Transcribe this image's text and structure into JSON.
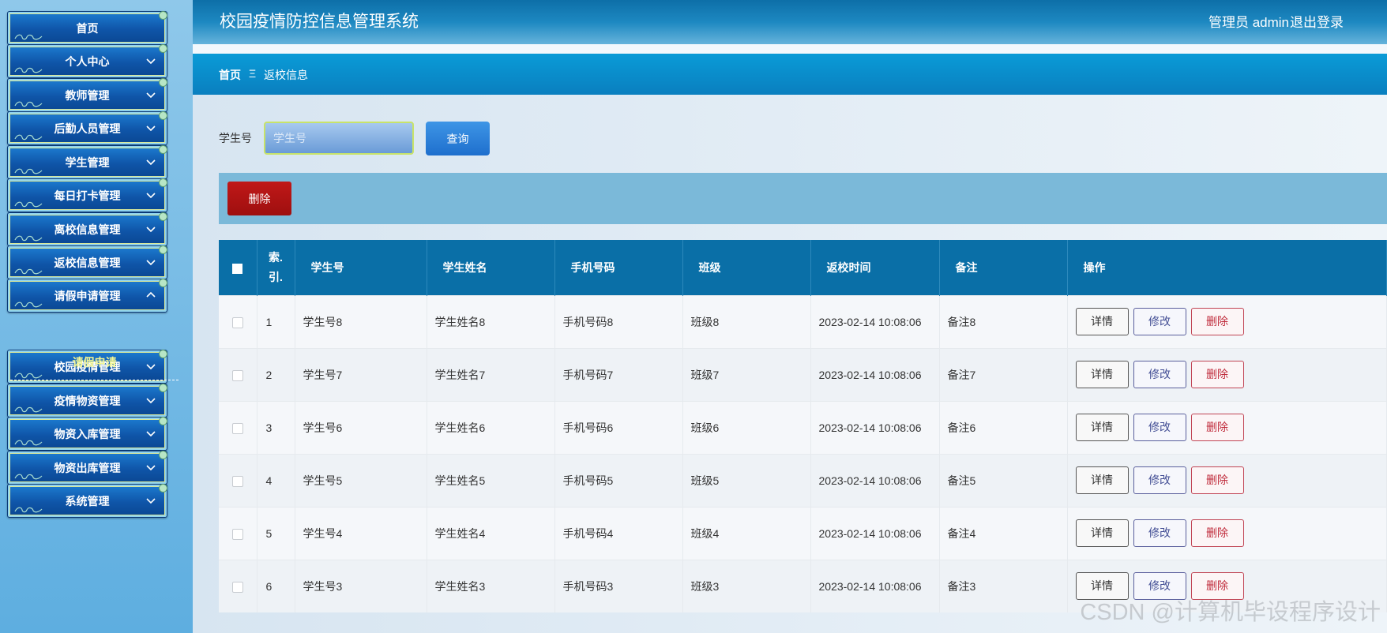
{
  "sidebar": {
    "items": [
      {
        "label": "首页",
        "has_chevron": false
      },
      {
        "label": "个人中心",
        "has_chevron": true
      },
      {
        "label": "教师管理",
        "has_chevron": true
      },
      {
        "label": "后勤人员管理",
        "has_chevron": true
      },
      {
        "label": "学生管理",
        "has_chevron": true
      },
      {
        "label": "每日打卡管理",
        "has_chevron": true
      },
      {
        "label": "离校信息管理",
        "has_chevron": true
      },
      {
        "label": "返校信息管理",
        "has_chevron": true
      },
      {
        "label": "请假申请管理",
        "has_chevron": true,
        "expanded": true
      },
      {
        "label": "校园疫情管理",
        "has_chevron": true
      },
      {
        "label": "疫情物资管理",
        "has_chevron": true
      },
      {
        "label": "物资入库管理",
        "has_chevron": true
      },
      {
        "label": "物资出库管理",
        "has_chevron": true
      },
      {
        "label": "系统管理",
        "has_chevron": true
      }
    ],
    "subitem": "请假申请"
  },
  "header": {
    "title": "校园疫情防控信息管理系统",
    "user": "管理员 admin",
    "logout": "退出登录"
  },
  "breadcrumb": {
    "home": "首页",
    "separator": "Ξ",
    "current": "返校信息"
  },
  "search": {
    "label": "学生号",
    "placeholder": "学生号",
    "button": "查询"
  },
  "toolbar": {
    "delete_label": "删除"
  },
  "table": {
    "columns": [
      "索.\n引.",
      "学生号",
      "学生姓名",
      "手机号码",
      "班级",
      "返校时间",
      "备注",
      "操作"
    ],
    "rows": [
      {
        "index": "1",
        "student_no": "学生号8",
        "name": "学生姓名8",
        "phone": "手机号码8",
        "class": "班级8",
        "time": "2023-02-14 10:08:06",
        "note": "备注8"
      },
      {
        "index": "2",
        "student_no": "学生号7",
        "name": "学生姓名7",
        "phone": "手机号码7",
        "class": "班级7",
        "time": "2023-02-14 10:08:06",
        "note": "备注7"
      },
      {
        "index": "3",
        "student_no": "学生号6",
        "name": "学生姓名6",
        "phone": "手机号码6",
        "class": "班级6",
        "time": "2023-02-14 10:08:06",
        "note": "备注6"
      },
      {
        "index": "4",
        "student_no": "学生号5",
        "name": "学生姓名5",
        "phone": "手机号码5",
        "class": "班级5",
        "time": "2023-02-14 10:08:06",
        "note": "备注5"
      },
      {
        "index": "5",
        "student_no": "学生号4",
        "name": "学生姓名4",
        "phone": "手机号码4",
        "class": "班级4",
        "time": "2023-02-14 10:08:06",
        "note": "备注4"
      },
      {
        "index": "6",
        "student_no": "学生号3",
        "name": "学生姓名3",
        "phone": "手机号码3",
        "class": "班级3",
        "time": "2023-02-14 10:08:06",
        "note": "备注3"
      }
    ],
    "actions": {
      "detail": "详情",
      "edit": "修改",
      "delete": "删除"
    }
  },
  "watermark": "CSDN @计算机毕设程序设计",
  "colors": {
    "topbar": "#0d6fa8",
    "crumbbar": "#0a8ccc",
    "table_header": "#0a6fa7",
    "delete_red": "#a81212",
    "query_blue": "#2a7fd8",
    "sidebar_button": "#1565b8",
    "subitem_text": "#f4f794"
  }
}
